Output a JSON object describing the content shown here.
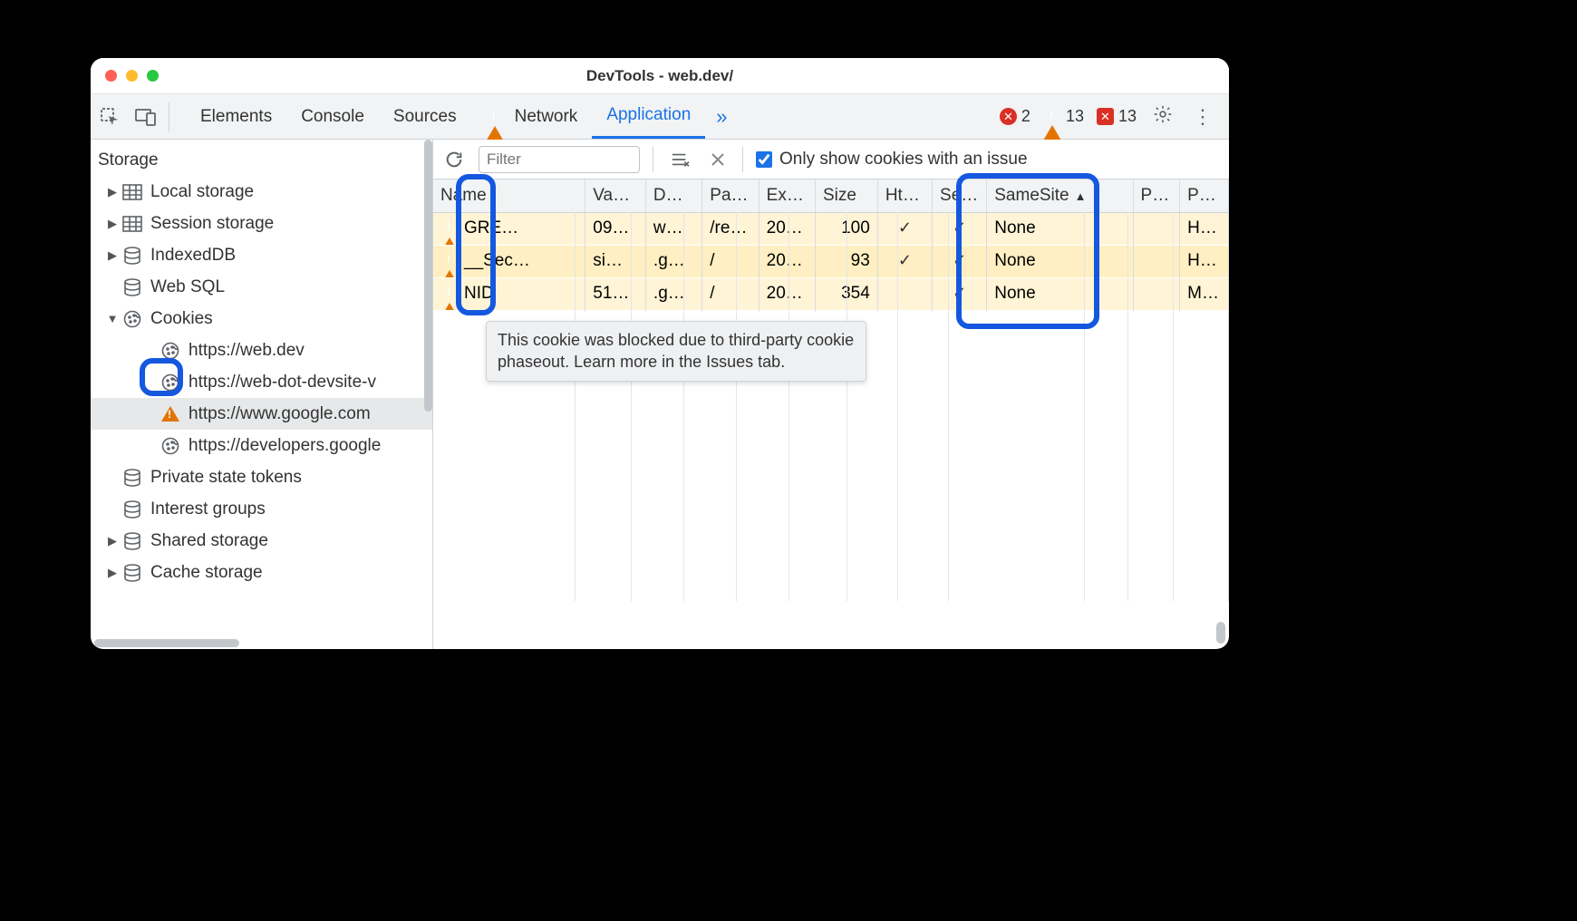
{
  "window": {
    "title": "DevTools - web.dev/"
  },
  "toolbar": {
    "tabs": [
      "Elements",
      "Console",
      "Sources",
      "Network",
      "Application"
    ],
    "active_tab": "Application",
    "network_has_warning": true,
    "error_count": "2",
    "warning_count": "13",
    "issues_count": "13"
  },
  "sidebar": {
    "section": "Storage",
    "items": [
      {
        "label": "Local storage",
        "icon": "table",
        "expandable": true,
        "expanded": false,
        "level": 1
      },
      {
        "label": "Session storage",
        "icon": "table",
        "expandable": true,
        "expanded": false,
        "level": 1
      },
      {
        "label": "IndexedDB",
        "icon": "database",
        "expandable": true,
        "expanded": false,
        "level": 1
      },
      {
        "label": "Web SQL",
        "icon": "database",
        "expandable": false,
        "expanded": false,
        "level": 1
      },
      {
        "label": "Cookies",
        "icon": "cookie",
        "expandable": true,
        "expanded": true,
        "level": 1
      },
      {
        "label": "https://web.dev",
        "icon": "cookie",
        "level": 2
      },
      {
        "label": "https://web-dot-devsite-v",
        "icon": "cookie",
        "level": 2
      },
      {
        "label": "https://www.google.com",
        "icon": "warning",
        "level": 2,
        "selected": true
      },
      {
        "label": "https://developers.google",
        "icon": "cookie",
        "level": 2
      },
      {
        "label": "Private state tokens",
        "icon": "database",
        "expandable": false,
        "level": 1
      },
      {
        "label": "Interest groups",
        "icon": "database",
        "expandable": false,
        "level": 1
      },
      {
        "label": "Shared storage",
        "icon": "database",
        "expandable": true,
        "expanded": false,
        "level": 1
      },
      {
        "label": "Cache storage",
        "icon": "database",
        "expandable": true,
        "expanded": false,
        "level": 1
      }
    ]
  },
  "filterbar": {
    "placeholder": "Filter",
    "only_issues_label": "Only show cookies with an issue",
    "only_issues_checked": true
  },
  "table": {
    "columns": [
      "Name",
      "Va…",
      "D…",
      "Pa…",
      "Ex…",
      "Size",
      "Ht…",
      "Se…",
      "SameSite",
      "P…",
      "P…"
    ],
    "sort_column": "SameSite",
    "sort_dir": "asc",
    "rows": [
      {
        "warn": true,
        "name": "GRE…",
        "value": "09…",
        "domain": "w…",
        "path": "/re…",
        "expires": "20…",
        "size": "100",
        "http": "✓",
        "secure": "✓",
        "samesite": "None",
        "p1": "",
        "p2": "H…"
      },
      {
        "warn": true,
        "name": "__Sec…",
        "value": "si…",
        "domain": ".g…",
        "path": "/",
        "expires": "20…",
        "size": "93",
        "http": "✓",
        "secure": "✓",
        "samesite": "None",
        "p1": "",
        "p2": "H…"
      },
      {
        "warn": true,
        "name": "NID",
        "value": "51…",
        "domain": ".g…",
        "path": "/",
        "expires": "20…",
        "size": "354",
        "http": "",
        "secure": "✓",
        "samesite": "None",
        "p1": "",
        "p2": "M…"
      }
    ]
  },
  "tooltip": "This cookie was blocked due to third-party cookie phaseout. Learn more in the Issues tab."
}
